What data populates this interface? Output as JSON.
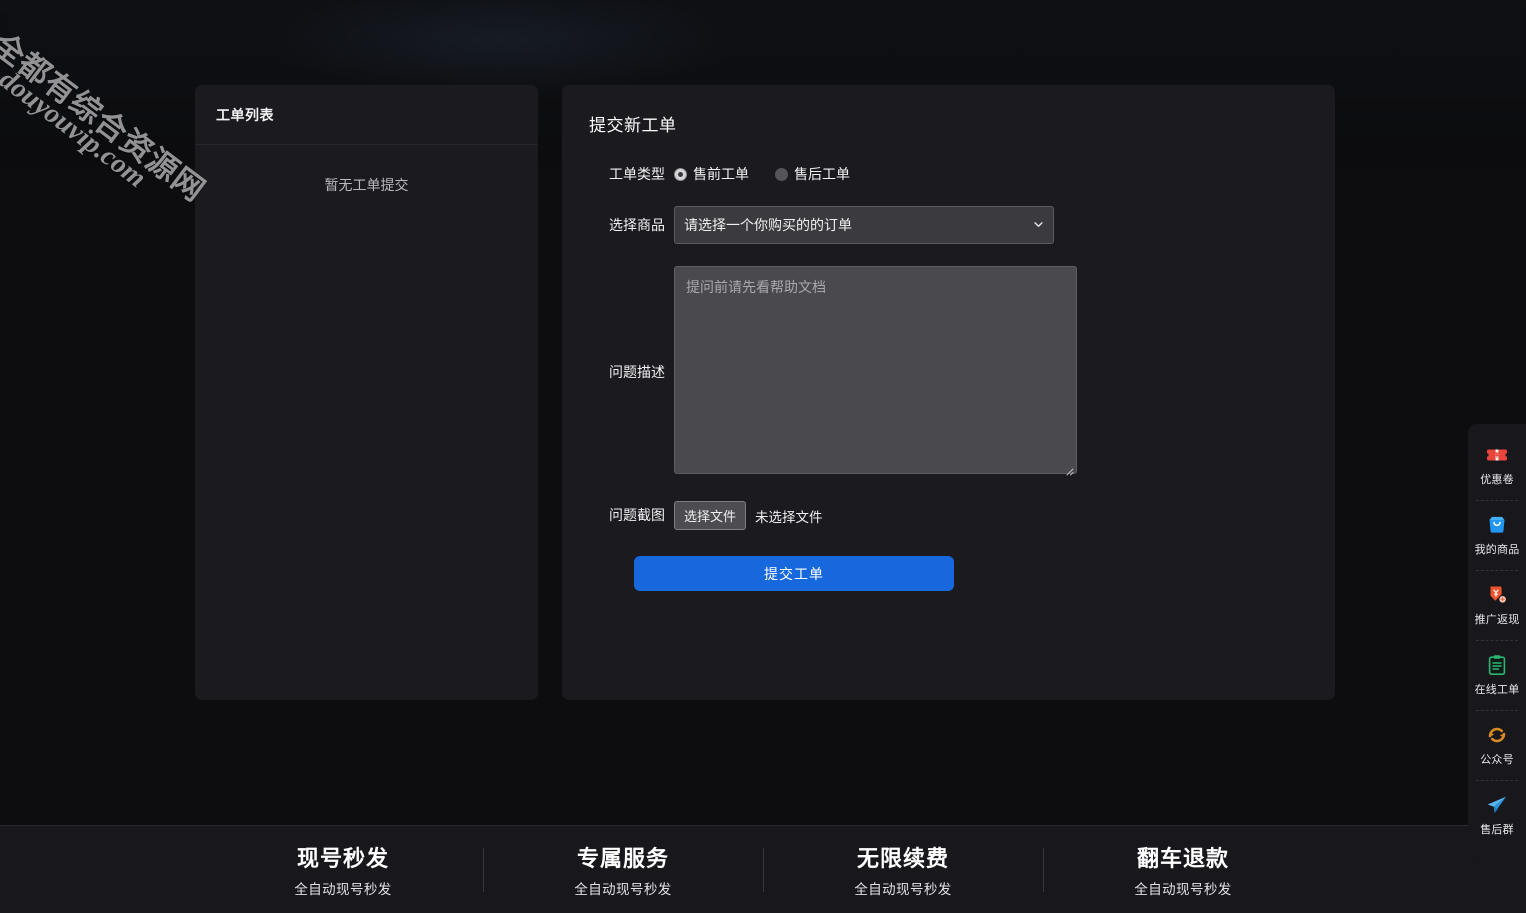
{
  "watermark": {
    "cn": "全都有综合资源网",
    "en": "douyouvip.com"
  },
  "ticket_panel": {
    "title": "工单列表",
    "empty_text": "暂无工单提交"
  },
  "form": {
    "title": "提交新工单",
    "type_label": "工单类型",
    "type_options": [
      {
        "label": "售前工单",
        "checked": true
      },
      {
        "label": "售后工单",
        "checked": false
      }
    ],
    "product_label": "选择商品",
    "product_selected": "请选择一个你购买的的订单",
    "desc_label": "问题描述",
    "desc_value": "",
    "desc_placeholder": "提问前请先看帮助文档",
    "screenshot_label": "问题截图",
    "file_button": "选择文件",
    "file_status": "未选择文件",
    "submit_label": "提交工单"
  },
  "dock": {
    "items": [
      {
        "label": "优惠卷",
        "icon": "coupon-icon",
        "color": "#e8453c"
      },
      {
        "label": "我的商品",
        "icon": "shopping-bag-icon",
        "color": "#2196f3"
      },
      {
        "label": "推广返现",
        "icon": "cashback-hand-icon",
        "color": "#f0542e"
      },
      {
        "label": "在线工单",
        "icon": "clipboard-icon",
        "color": "#2bb673"
      },
      {
        "label": "公众号",
        "icon": "refresh-circle-icon",
        "color": "#d98a21"
      },
      {
        "label": "售后群",
        "icon": "paper-plane-icon",
        "color": "#3da8e8"
      }
    ]
  },
  "footer": {
    "cells": [
      {
        "title": "现号秒发",
        "sub": "全自动现号秒发"
      },
      {
        "title": "专属服务",
        "sub": "全自动现号秒发"
      },
      {
        "title": "无限续费",
        "sub": "全自动现号秒发"
      },
      {
        "title": "翻车退款",
        "sub": "全自动现号秒发"
      }
    ]
  },
  "theme": {
    "page_bg": "#0d0d0f",
    "panel_bg": "#1a1a1f",
    "accent": "#1668dc",
    "footer_bg": "#17171c"
  }
}
